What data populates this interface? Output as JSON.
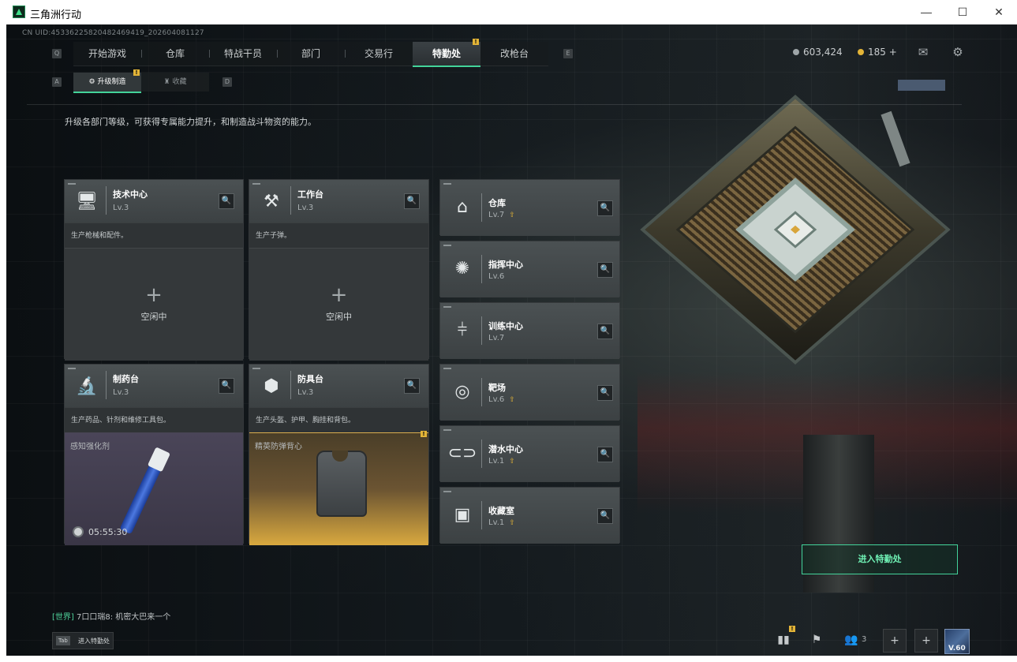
{
  "window": {
    "title": "三角洲行动",
    "minimize": "—",
    "maximize": "☐",
    "close": "✕"
  },
  "uid": "CN UID:4533622582048246941​9_202604081127",
  "nav": {
    "key_left": "Q",
    "key_right": "E",
    "tabs": [
      {
        "label": "开始游戏"
      },
      {
        "label": "仓库"
      },
      {
        "label": "特战干员"
      },
      {
        "label": "部门"
      },
      {
        "label": "交易行"
      },
      {
        "label": "特勤处",
        "active": true,
        "badge": "!"
      },
      {
        "label": "改枪台"
      }
    ]
  },
  "currency": {
    "silver": "603,424",
    "gold": "185 +"
  },
  "subnav": {
    "key_left": "A",
    "key_right": "D",
    "tabs": [
      {
        "label": "升级制造",
        "active": true,
        "badge": "!"
      },
      {
        "label": "收藏"
      }
    ]
  },
  "description": "升级各部门等级，可获得专属能力提升，和制造战斗物资的能力。",
  "workstations": [
    {
      "title": "技术中心",
      "level": "Lv.3",
      "desc": "生产枪械和配件。",
      "status": "空闲中"
    },
    {
      "title": "工作台",
      "level": "Lv.3",
      "desc": "生产子弹。",
      "status": "空闲中"
    },
    {
      "title": "制药台",
      "level": "Lv.3",
      "desc": "生产药品、针剂和维修工具包。",
      "item": "感知强化剂",
      "timer": "05:55:30"
    },
    {
      "title": "防具台",
      "level": "Lv.3",
      "desc": "生产头盔、护甲、胸挂和背包。",
      "item": "精英防弹背心",
      "badge": "!"
    }
  ],
  "facilities": [
    {
      "title": "仓库",
      "level": "Lv.7",
      "upgrade": true
    },
    {
      "title": "指挥中心",
      "level": "Lv.6",
      "upgrade": false
    },
    {
      "title": "训练中心",
      "level": "Lv.7",
      "upgrade": false
    },
    {
      "title": "靶场",
      "level": "Lv.6",
      "upgrade": true
    },
    {
      "title": "潜水中心",
      "level": "Lv.1",
      "upgrade": true
    },
    {
      "title": "收藏室",
      "level": "Lv.1",
      "upgrade": true
    }
  ],
  "chat": {
    "channel": "[世界]",
    "sender": "7口口瑞8:",
    "message": "机密大巴来一个"
  },
  "tab_hint": {
    "key": "Tab",
    "label": "进入特勤处"
  },
  "enter_button": "进入特勤处",
  "party_count": "3",
  "avatar_level": "V.60",
  "colors": {
    "accent": "#43d39a",
    "badge": "#e3b437",
    "background": "#11161a"
  }
}
